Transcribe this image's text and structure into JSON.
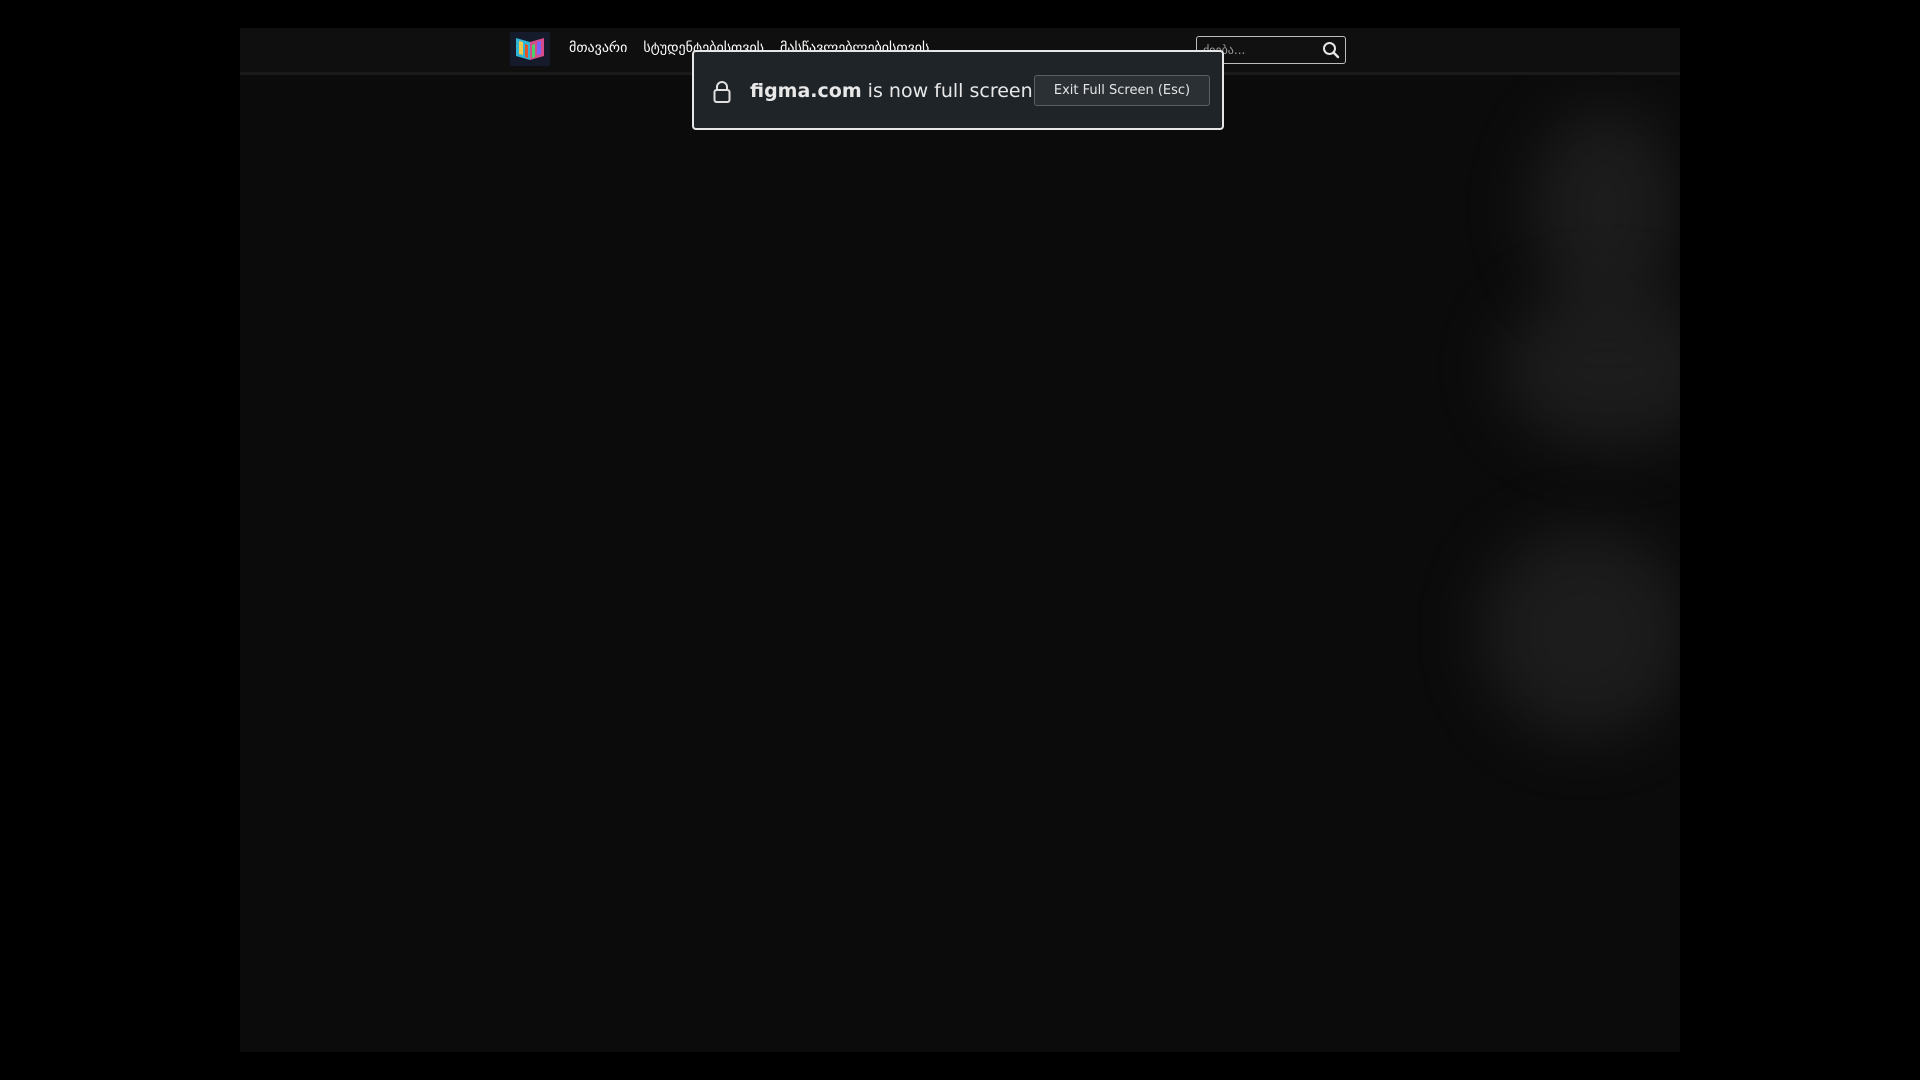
{
  "navbar": {
    "links": [
      "მთავარი",
      "სტუდენტებისთვის",
      "მასწავლებლებისთვის"
    ],
    "search": {
      "placeholder": "ძიება..."
    }
  },
  "fullscreen_notice": {
    "domain": "figma.com",
    "message": " is now full screen",
    "exit_label": "Exit Full Screen (Esc)"
  },
  "icons": {
    "logo": "open-book-logo",
    "search": "search-icon",
    "lock": "lock-icon"
  },
  "colors": {
    "background": "#000000",
    "frame": "#0b0b0b",
    "notice_bg": "#1f2428",
    "notice_border": "#e6e6e6",
    "text": "#ffffff"
  }
}
